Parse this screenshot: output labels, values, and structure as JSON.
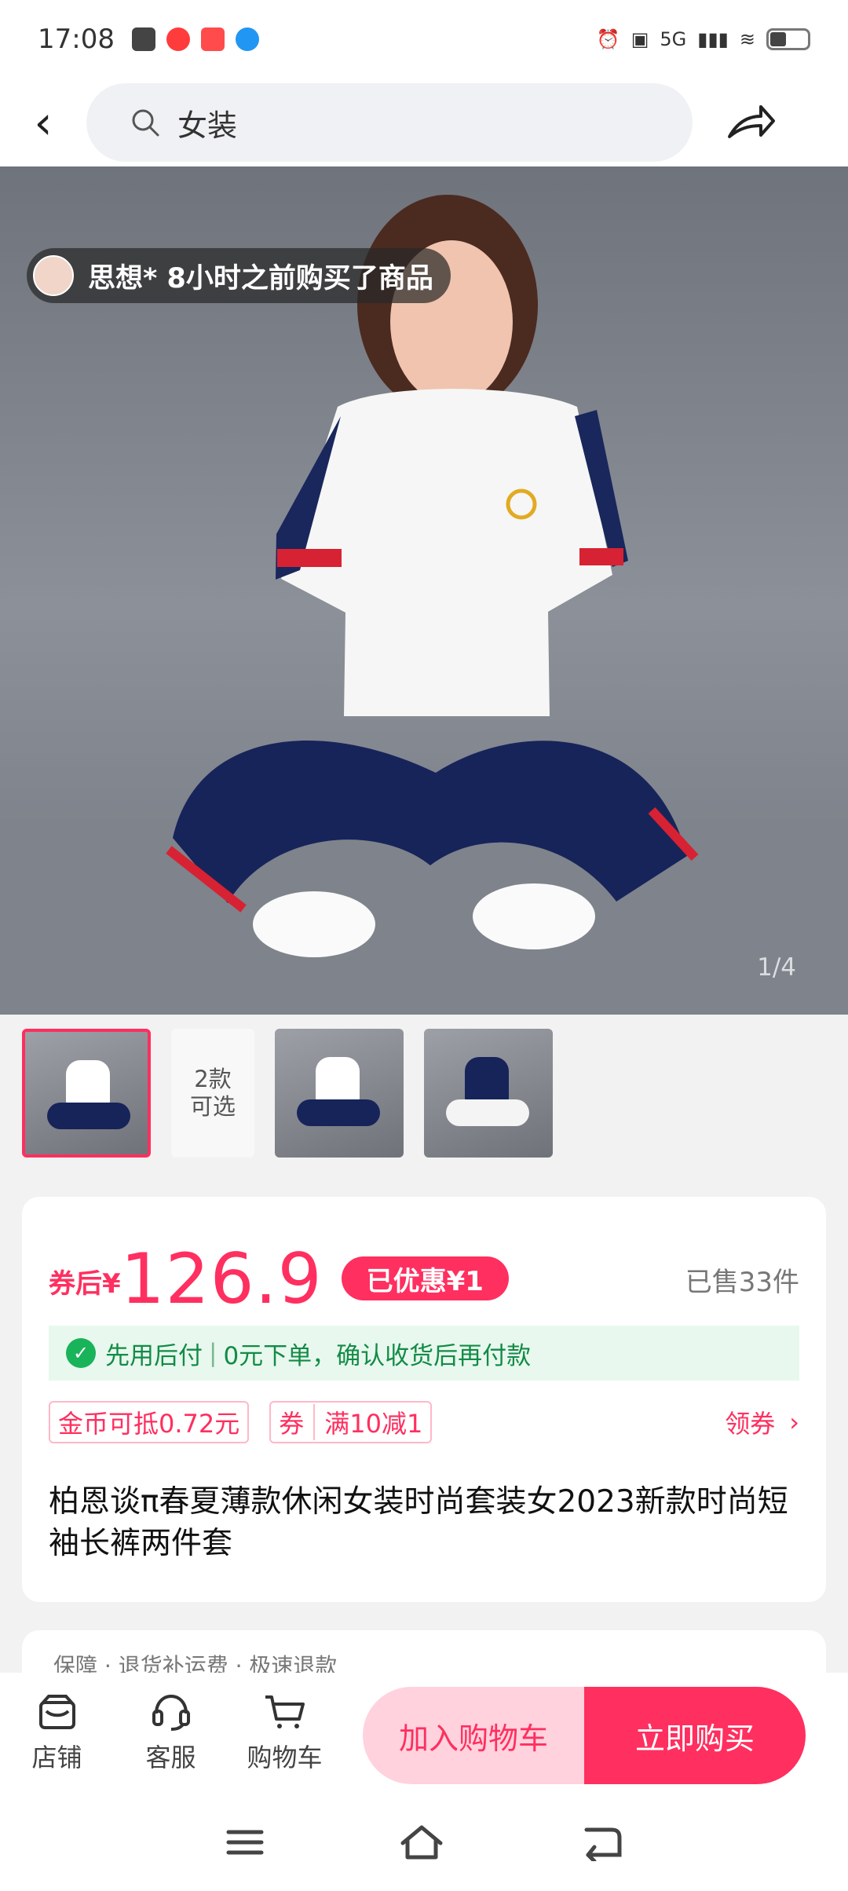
{
  "status": {
    "time": "17:08",
    "network": "5G"
  },
  "search": {
    "value": "女装"
  },
  "hero": {
    "buyer_message": "思想* 8小时之前购买了商品",
    "page_indicator": "1/4"
  },
  "thumbnails": {
    "styles_text": "2款\n可选"
  },
  "product": {
    "price_prefix": "券后¥",
    "price": "126.9",
    "discount": "已优惠¥1",
    "sold": "已售33件",
    "pay_later_label": "先用后付",
    "pay_later_text": "0元下单，确认收货后再付款",
    "coin_offer": "金币可抵0.72元",
    "coupon_tag": "券",
    "coupon_text": "满10减1",
    "claim_coupon": "领券",
    "title": "柏恩谈π春夏薄款休闲女装时尚套装女2023新款时尚短袖长裤两件套"
  },
  "partial_card": {
    "text": "保障 · 退货补运费 · 极速退款"
  },
  "bottom": {
    "store": "店铺",
    "service": "客服",
    "cart": "购物车",
    "add_to_cart": "加入购物车",
    "buy_now": "立即购买"
  }
}
